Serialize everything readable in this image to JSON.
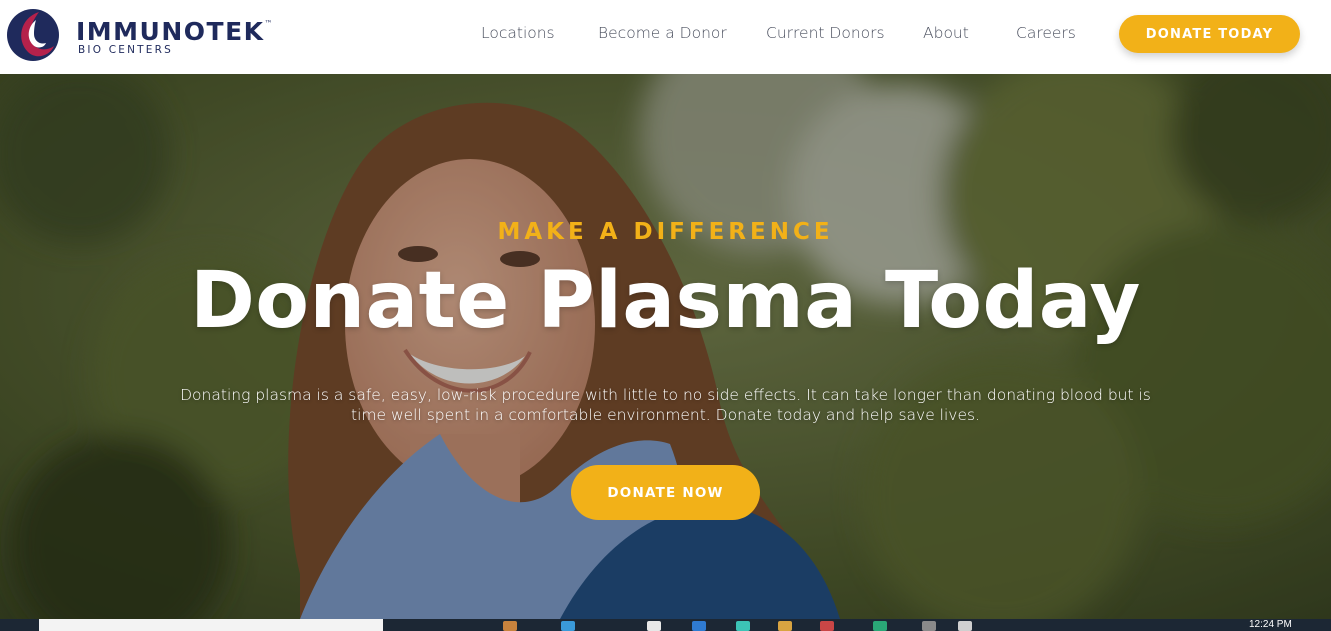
{
  "brand": {
    "name": "IMMUNOTEK",
    "trademark": "™",
    "subtitle": "BIO CENTERS"
  },
  "nav": {
    "items": [
      {
        "label": "Locations"
      },
      {
        "label": "Become a Donor"
      },
      {
        "label": "Current Donors"
      },
      {
        "label": "About"
      },
      {
        "label": "Careers"
      }
    ],
    "cta_label": "DONATE TODAY"
  },
  "hero": {
    "eyebrow": "MAKE A DIFFERENCE",
    "title": "Donate Plasma Today",
    "body": "Donating plasma is a safe, easy, low-risk procedure with little to no side effects. It can take longer than donating blood but is time well spent in a comfortable environment. Donate today and help save lives.",
    "cta_label": "DONATE NOW"
  },
  "taskbar": {
    "clock": "12:24 PM"
  },
  "colors": {
    "accent": "#f2b118",
    "brand_navy": "#1f2a5c",
    "brand_crimson": "#b5214b"
  }
}
